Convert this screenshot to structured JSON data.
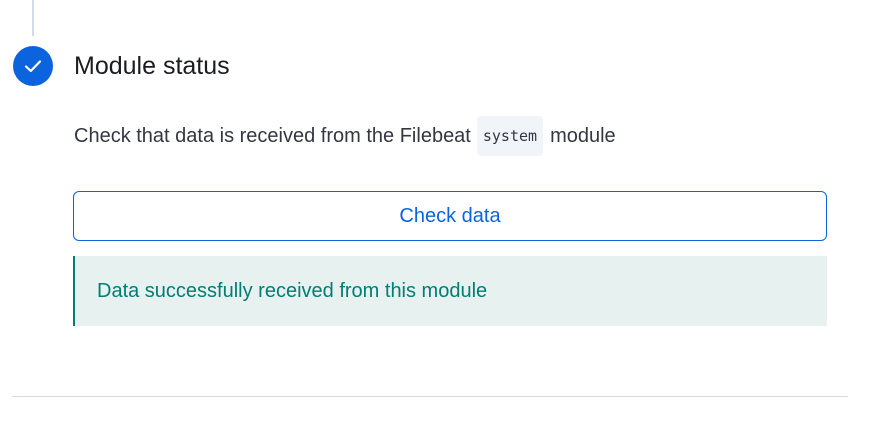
{
  "step": {
    "title": "Module status",
    "status_icon": "check-icon",
    "accent_color": "#0b64dd"
  },
  "description": {
    "prefix": "Check that data is received from the Filebeat",
    "code": "system",
    "suffix": "module"
  },
  "check_button": {
    "label": "Check data"
  },
  "callout": {
    "message": "Data successfully received from this module",
    "color": "#017d73",
    "background": "#e6f1f0"
  }
}
